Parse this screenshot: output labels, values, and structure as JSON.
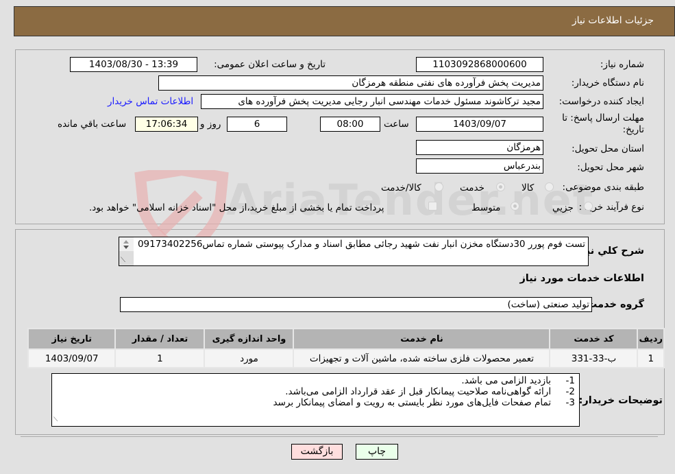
{
  "header": {
    "title": "جزئیات اطلاعات نیاز"
  },
  "details": {
    "need_number_label": "شماره نیاز:",
    "need_number": "1103092868000600",
    "announce_label": "تاریخ و ساعت اعلان عمومی:",
    "announce_value": "1403/08/30 - 13:39",
    "buyer_org_label": "نام دستگاه خریدار:",
    "buyer_org": "مدیریت پخش فرآورده های نفتی منطقه هرمزگان",
    "creator_label": "ایجاد کننده درخواست:",
    "creator": "مجید ترکاشوند مسئول خدمات مهندسی انبار رجایی مدیریت پخش فرآورده های",
    "contact_link": "اطلاعات تماس خریدار",
    "deadline_label": "مهلت ارسال پاسخ: تا تاریخ:",
    "deadline_date": "1403/09/07",
    "time_label": "ساعت",
    "deadline_time": "08:00",
    "days_value": "6",
    "days_label": "روز و",
    "remaining_time": "17:06:34",
    "remaining_label": "ساعت باقي مانده",
    "province_label": "استان محل تحویل:",
    "province": "هرمزگان",
    "city_label": "شهر محل تحویل:",
    "city": "بندرعباس",
    "category_label": "طبقه بندی موضوعی:",
    "category_options": [
      "کالا",
      "خدمت",
      "کالا/خدمت"
    ],
    "category_selected": "خدمت",
    "process_label": "نوع فرآیند خرید :",
    "process_options": [
      "جزیي",
      "متوسط"
    ],
    "process_selected": "متوسط",
    "treasury_note": "پرداخت تمام یا بخشی از مبلغ خرید،از محل \"اسناد خزانه اسلامی\" خواهد بود."
  },
  "description": {
    "label": "شرح کلي نیاز:",
    "text": "تست فوم پورر 30دستگاه مخزن انبار نفت شهید رجائی مطابق اسناد و مدارک پیوستی شماره تماس09173402256"
  },
  "services": {
    "section_title": "اطلاعات خدمات مورد نیاز",
    "group_label": "گروه خدمت:",
    "group_value": "تولید صنعتی (ساخت)",
    "columns": [
      "ردیف",
      "کد خدمت",
      "نام خدمت",
      "واحد اندازه گیری",
      "تعداد / مقدار",
      "تاریخ نیاز"
    ],
    "rows": [
      [
        "1",
        "ب-33-331",
        "تعمیر محصولات فلزی ساخته شده، ماشین آلات و تجهیزات",
        "مورد",
        "1",
        "1403/09/07"
      ]
    ]
  },
  "buyer_notes": {
    "label": "توضیحات خریدار:",
    "lines": [
      "1-     بازدید الزامی می باشد.",
      "2-     ارائه گواهی‌نامه صلاحیت پیمانکار قبل از عقد قرارداد الزامی می‌باشد.",
      "3-     تمام صفحات فایل‌های مورد نظر بایستی به رویت و امضای پیمانکار برسد"
    ]
  },
  "buttons": {
    "print": "چاپ",
    "back": "بازگشت"
  },
  "watermark": {
    "text": "AriaTender.net"
  }
}
